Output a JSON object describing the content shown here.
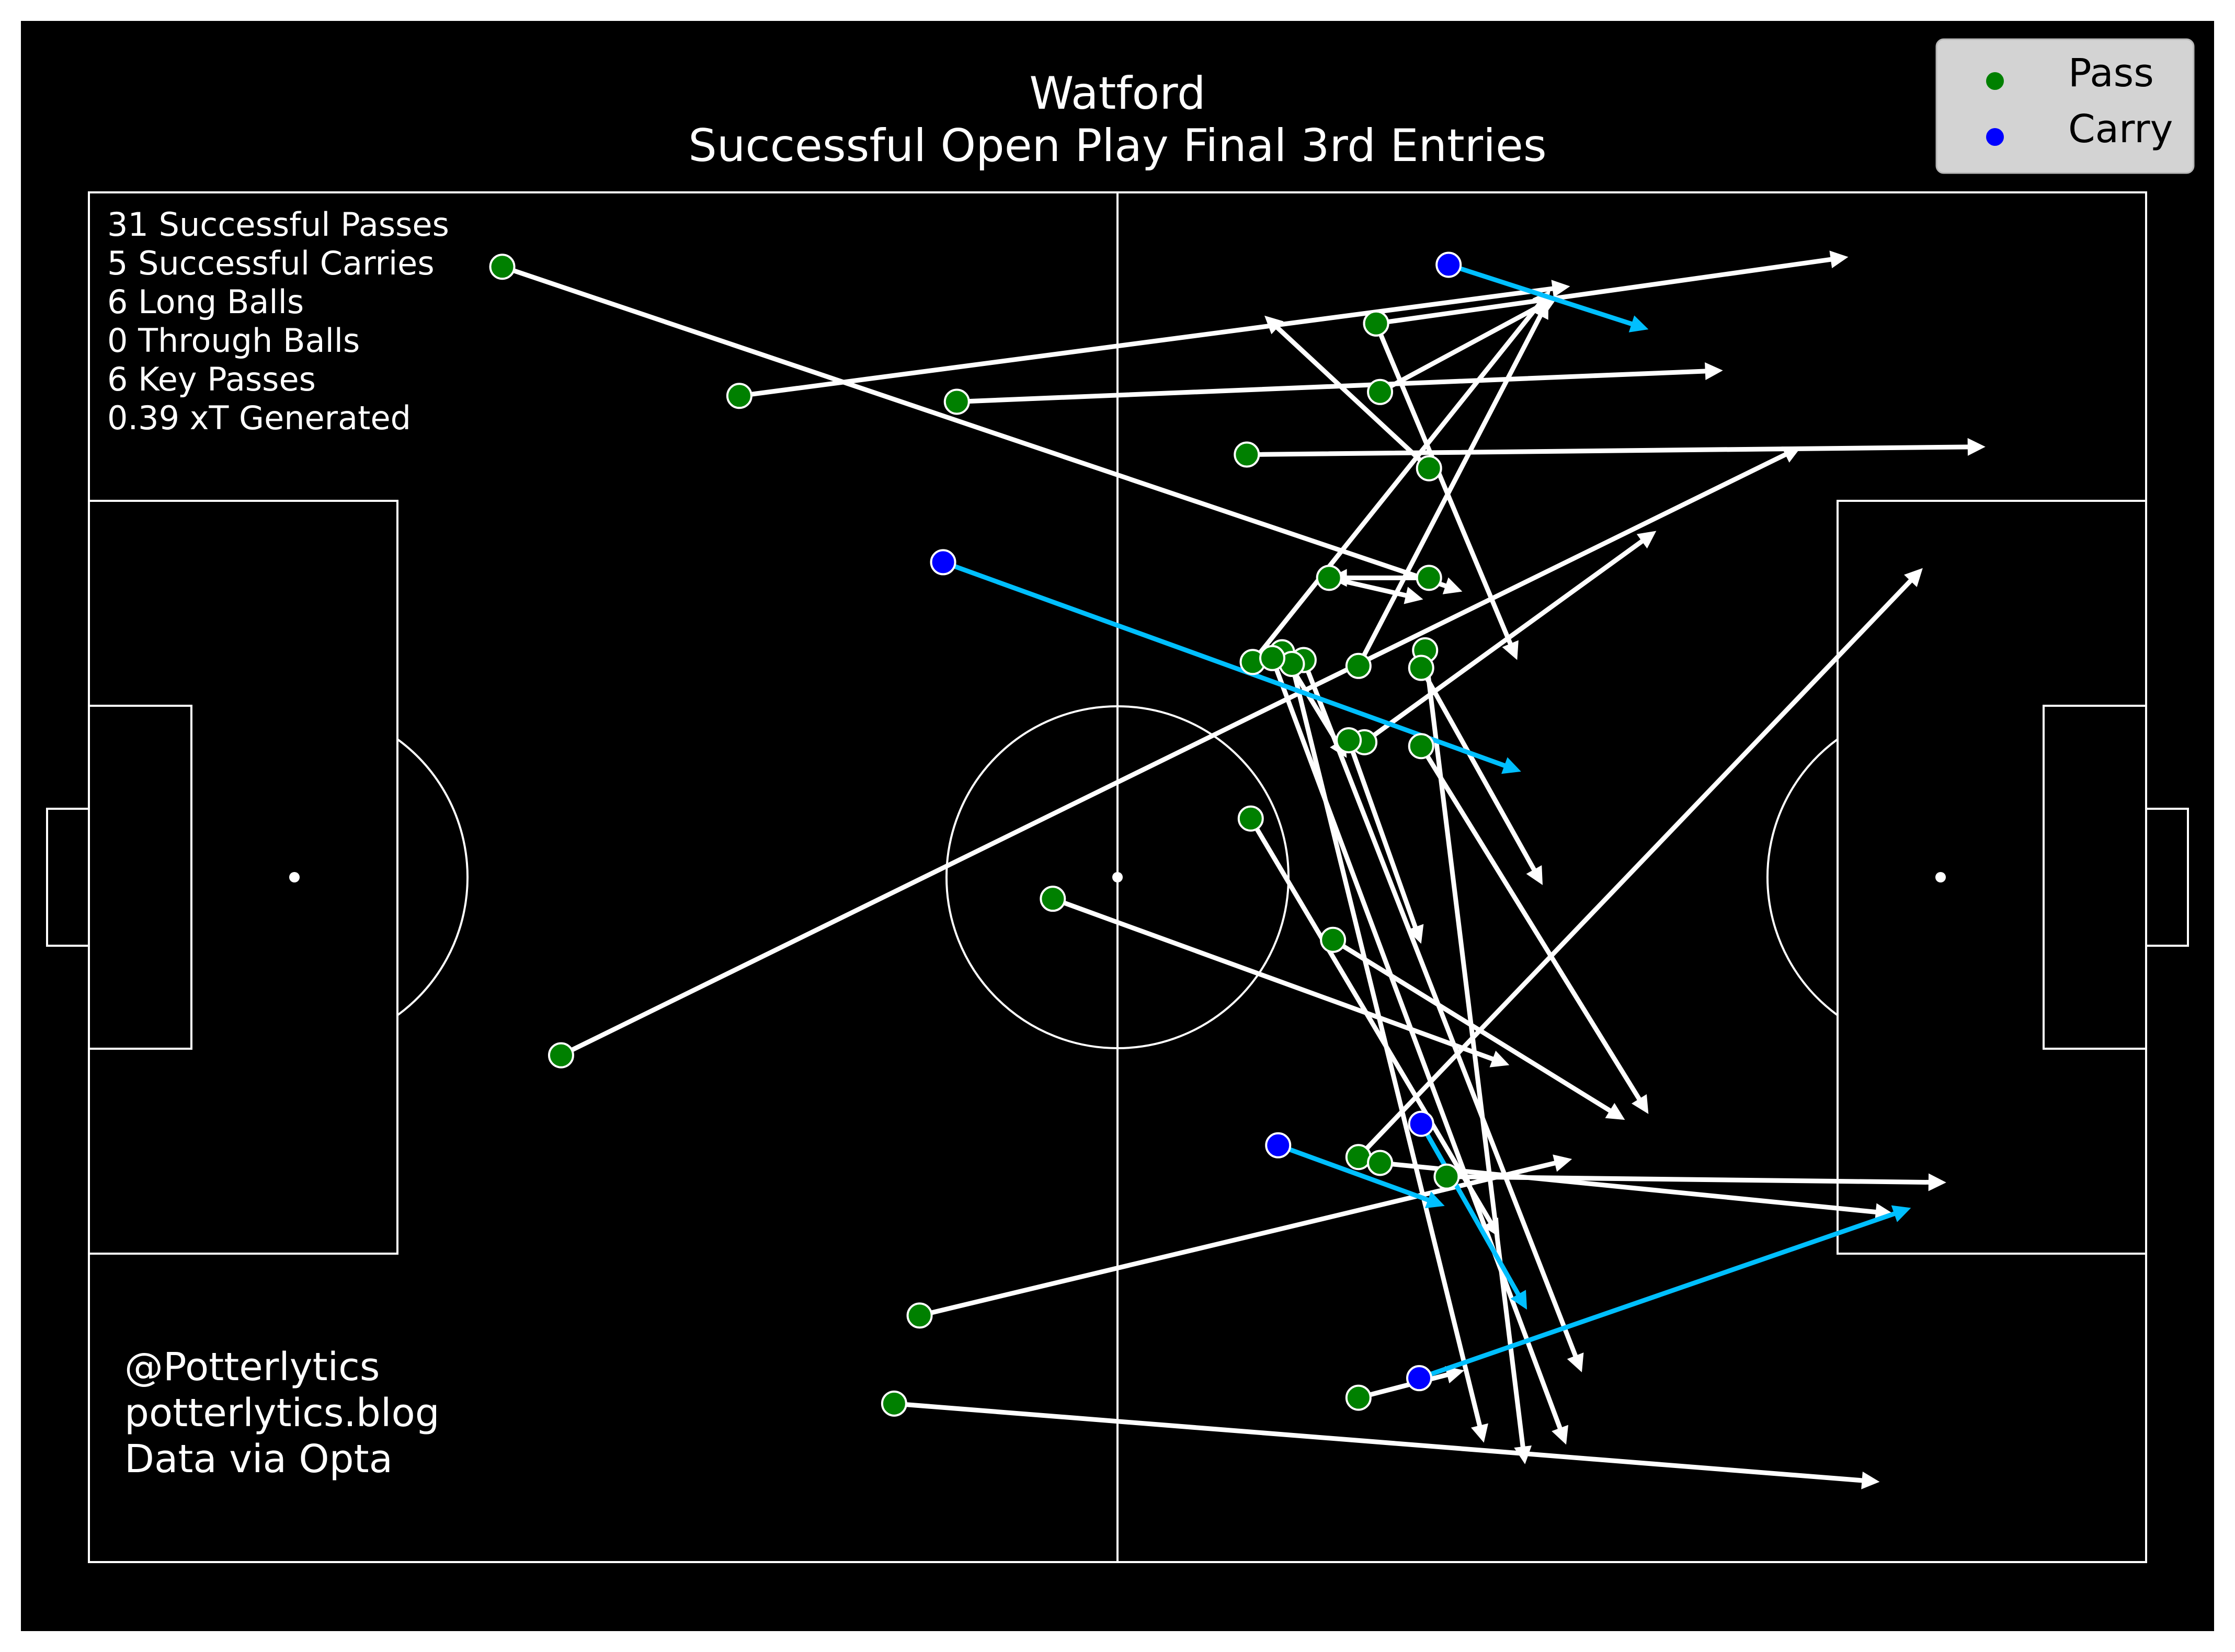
{
  "title": "Watford",
  "subtitle": "Successful Open Play Final 3rd Entries",
  "stats": [
    "31 Successful Passes",
    "5 Successful Carries",
    "6 Long Balls",
    "0 Through Balls",
    "6 Key Passes",
    "0.39 xT Generated"
  ],
  "credits": [
    "@Potterlytics",
    "potterlytics.blog",
    "Data via Opta"
  ],
  "colors": {
    "pitch_background": "#000000",
    "pitch_lines": "#ffffff",
    "pass_arrow": "#ffffff",
    "carry_arrow": "#00bfff",
    "pass_marker": "#008000",
    "carry_marker": "#0000ff",
    "legend_background": "#d3d3d3"
  },
  "chart_data": {
    "type": "scatter",
    "title": "Watford",
    "subtitle": "Successful Open Play Final 3rd Entries",
    "xlim": [
      0,
      105
    ],
    "ylim": [
      0,
      70
    ],
    "legend": {
      "placement": "top-right",
      "entries": [
        "Pass",
        "Carry"
      ]
    },
    "series": [
      {
        "name": "Pass",
        "marker_color": "#008000",
        "arrow_color": "#ffffff",
        "events": [
          {
            "x": 21.1,
            "y": 66.2,
            "end_x": 70.1,
            "end_y": 49.6
          },
          {
            "x": 33.2,
            "y": 59.6,
            "end_x": 75.6,
            "end_y": 65.2
          },
          {
            "x": 44.3,
            "y": 59.3,
            "end_x": 83.4,
            "end_y": 60.9
          },
          {
            "x": 59.1,
            "y": 56.6,
            "end_x": 96.8,
            "end_y": 57.0
          },
          {
            "x": 24.1,
            "y": 25.9,
            "end_x": 87.4,
            "end_y": 57.0
          },
          {
            "x": 49.2,
            "y": 33.9,
            "end_x": 72.5,
            "end_y": 25.4
          },
          {
            "x": 59.3,
            "y": 38.0,
            "end_x": 72.0,
            "end_y": 16.6
          },
          {
            "x": 63.5,
            "y": 31.8,
            "end_x": 78.4,
            "end_y": 22.6
          },
          {
            "x": 42.4,
            "y": 12.6,
            "end_x": 75.7,
            "end_y": 20.6
          },
          {
            "x": 41.1,
            "y": 8.1,
            "end_x": 91.4,
            "end_y": 4.1
          },
          {
            "x": 65.7,
            "y": 63.3,
            "end_x": 89.8,
            "end_y": 66.7
          },
          {
            "x": 65.9,
            "y": 59.8,
            "end_x": 75.0,
            "end_y": 64.7
          },
          {
            "x": 68.4,
            "y": 55.9,
            "end_x": 60.0,
            "end_y": 63.7
          },
          {
            "x": 65.7,
            "y": 63.3,
            "end_x": 72.9,
            "end_y": 46.1
          },
          {
            "x": 68.4,
            "y": 50.3,
            "end_x": 63.3,
            "end_y": 50.3
          },
          {
            "x": 63.3,
            "y": 50.3,
            "end_x": 68.1,
            "end_y": 49.2
          },
          {
            "x": 59.4,
            "y": 46.0,
            "end_x": 74.6,
            "end_y": 65.0
          },
          {
            "x": 60.9,
            "y": 46.5,
            "end_x": 64.2,
            "end_y": 41.1
          },
          {
            "x": 62.0,
            "y": 46.1,
            "end_x": 76.2,
            "end_y": 9.7
          },
          {
            "x": 64.8,
            "y": 45.8,
            "end_x": 74.5,
            "end_y": 64.5
          },
          {
            "x": 68.2,
            "y": 46.6,
            "end_x": 73.3,
            "end_y": 5.0
          },
          {
            "x": 68.0,
            "y": 45.7,
            "end_x": 74.2,
            "end_y": 34.6
          },
          {
            "x": 65.1,
            "y": 41.9,
            "end_x": 80.0,
            "end_y": 52.7
          },
          {
            "x": 68.0,
            "y": 41.7,
            "end_x": 79.6,
            "end_y": 22.9
          },
          {
            "x": 64.3,
            "y": 42.0,
            "end_x": 68.0,
            "end_y": 31.6
          },
          {
            "x": 61.4,
            "y": 45.9,
            "end_x": 71.2,
            "end_y": 6.1
          },
          {
            "x": 60.4,
            "y": 46.2,
            "end_x": 75.4,
            "end_y": 6.0
          },
          {
            "x": 64.8,
            "y": 20.7,
            "end_x": 93.6,
            "end_y": 50.8
          },
          {
            "x": 69.3,
            "y": 19.7,
            "end_x": 94.8,
            "end_y": 19.4
          },
          {
            "x": 65.9,
            "y": 20.4,
            "end_x": 92.1,
            "end_y": 17.8
          },
          {
            "x": 64.8,
            "y": 8.4,
            "end_x": 70.2,
            "end_y": 9.8
          }
        ]
      },
      {
        "name": "Carry",
        "marker_color": "#0000ff",
        "arrow_color": "#00bfff",
        "events": [
          {
            "x": 43.6,
            "y": 51.1,
            "end_x": 73.1,
            "end_y": 40.4
          },
          {
            "x": 69.4,
            "y": 66.3,
            "end_x": 79.6,
            "end_y": 63.0
          },
          {
            "x": 60.7,
            "y": 21.3,
            "end_x": 69.2,
            "end_y": 18.2
          },
          {
            "x": 68.0,
            "y": 22.4,
            "end_x": 73.4,
            "end_y": 12.9
          },
          {
            "x": 67.9,
            "y": 9.4,
            "end_x": 93.0,
            "end_y": 18.1
          }
        ]
      }
    ]
  }
}
